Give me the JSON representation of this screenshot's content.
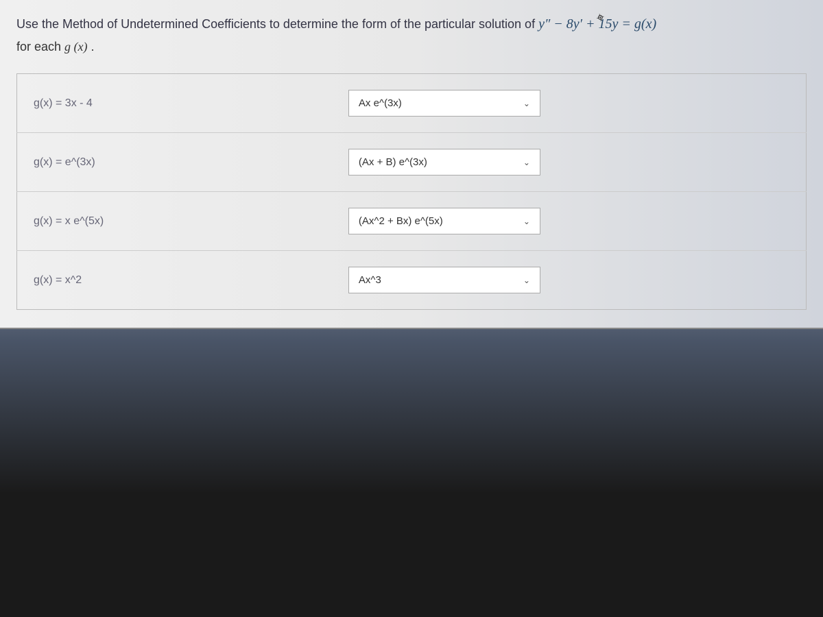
{
  "question": {
    "prompt_left": "Use the Method of Undetermined Coefficients to determine the form of the particular solution of ",
    "equation": "y″ − 8y′ + 15y = g(x)",
    "line2_left": "for each ",
    "line2_math": "g (x)",
    "line2_right": " ."
  },
  "rows": [
    {
      "label": "g(x) = 3x - 4",
      "selected": "Ax e^(3x)"
    },
    {
      "label": "g(x) = e^(3x)",
      "selected": "(Ax + B) e^(3x)"
    },
    {
      "label": "g(x) = x e^(5x)",
      "selected": "(Ax^2 + Bx) e^(5x)"
    },
    {
      "label": "g(x) = x^2",
      "selected": "Ax^3"
    }
  ]
}
